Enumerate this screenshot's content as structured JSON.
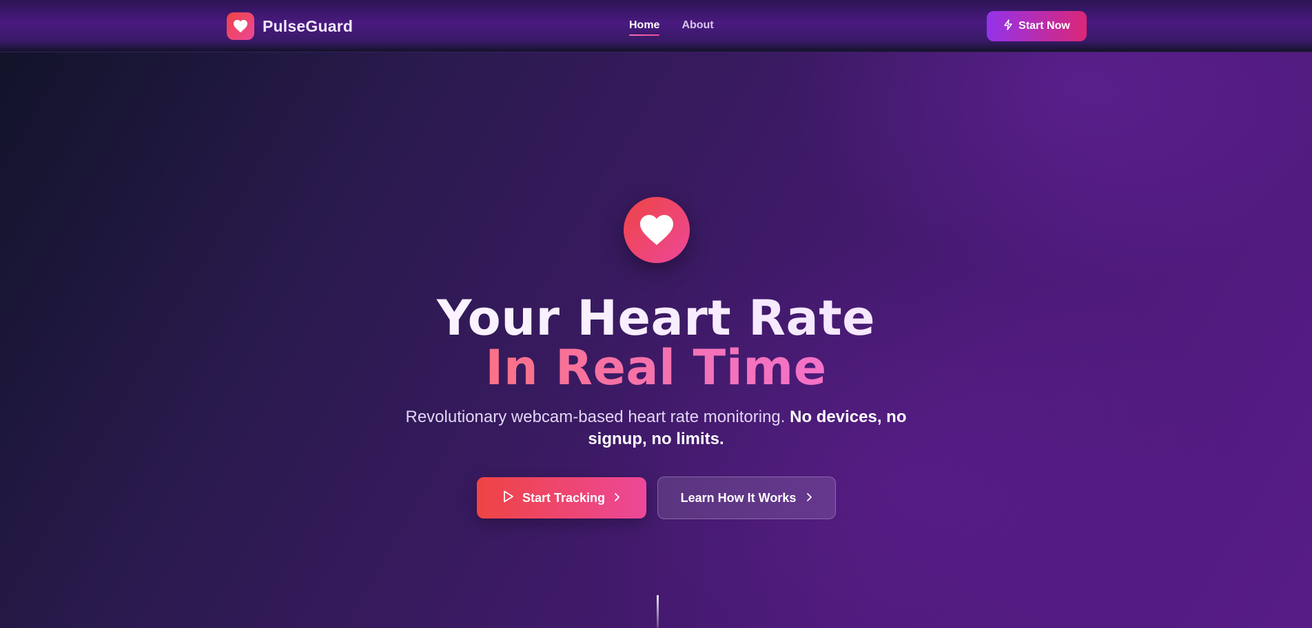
{
  "brand": {
    "name": "PulseGuard",
    "logo_icon": "heart-icon"
  },
  "nav": {
    "links": [
      {
        "label": "Home",
        "active": true
      },
      {
        "label": "About",
        "active": false
      }
    ],
    "cta_label": "Start Now",
    "cta_icon": "lightning-icon"
  },
  "hero": {
    "icon": "heart-icon",
    "title_line1": "Your Heart Rate",
    "title_line2": "In Real Time",
    "subtitle_plain": "Revolutionary webcam-based heart rate monitoring.",
    "subtitle_bold": "No devices, no signup, no limits.",
    "primary_button": {
      "label": "Start Tracking",
      "icon": "play-icon",
      "trailing_icon": "chevron-right-icon"
    },
    "secondary_button": {
      "label": "Learn How It Works",
      "trailing_icon": "chevron-right-icon"
    }
  },
  "colors": {
    "accent_gradient_start": "#ef4444",
    "accent_gradient_end": "#ec4899",
    "cta_gradient_start": "#9333ea",
    "cta_gradient_end": "#db2777",
    "background_dark": "#101327",
    "background_purple": "#581c87"
  }
}
